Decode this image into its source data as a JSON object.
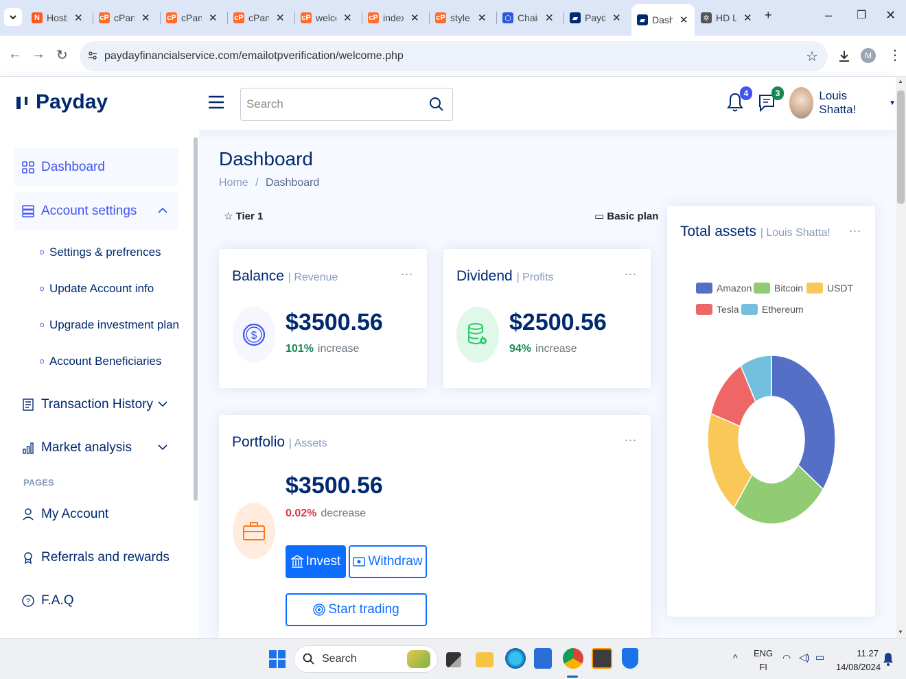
{
  "browser": {
    "tabs": [
      {
        "label": "Hostinger",
        "icon": "hostinger-icon"
      },
      {
        "label": "cPanel",
        "icon": "cpanel-icon"
      },
      {
        "label": "cPanel",
        "icon": "cpanel-icon"
      },
      {
        "label": "cPanel",
        "icon": "cpanel-icon"
      },
      {
        "label": "welcome",
        "icon": "cpanel-icon"
      },
      {
        "label": "index",
        "icon": "cpanel-icon"
      },
      {
        "label": "style",
        "icon": "cpanel-icon"
      },
      {
        "label": "Chain",
        "icon": "chainlink-icon"
      },
      {
        "label": "Payday",
        "icon": "payday-icon"
      },
      {
        "label": "Dashboard",
        "icon": "payday-icon",
        "active": true
      },
      {
        "label": "HD Lines",
        "icon": "openai-icon"
      }
    ],
    "url": "paydayfinancialservice.com/emailotpverification/welcome.php",
    "profile_initial": "M"
  },
  "header": {
    "logo_text": "Payday",
    "search_placeholder": "Search",
    "notifications_count": "4",
    "messages_count": "3",
    "user_name": "Louis Shatta!"
  },
  "sidebar": {
    "dashboard": "Dashboard",
    "account_settings": "Account settings",
    "sub_items": [
      "Settings & prefrences",
      "Update Account info",
      "Upgrade investment plan",
      "Account Beneficiaries"
    ],
    "transaction_history": "Transaction History",
    "market_analysis": "Market analysis",
    "pages_heading": "PAGES",
    "my_account": "My Account",
    "referrals": "Referrals and rewards",
    "faq": "F.A.Q"
  },
  "main": {
    "title": "Dashboard",
    "breadcrumb_home": "Home",
    "breadcrumb_sep": "/",
    "breadcrumb_current": "Dashboard",
    "tier": "Tier 1",
    "plan": "Basic plan",
    "balance": {
      "title": "Balance",
      "subtitle": "| Revenue",
      "amount": "$3500.56",
      "pct": "101%",
      "trend": "increase"
    },
    "dividend": {
      "title": "Dividend",
      "subtitle": "| Profits",
      "amount": "$2500.56",
      "pct": "94%",
      "trend": "increase"
    },
    "portfolio": {
      "title": "Portfolio",
      "subtitle": "| Assets",
      "amount": "$3500.56",
      "pct": "0.02%",
      "trend": "decrease",
      "invest": "Invest",
      "withdraw": "Withdraw",
      "start_trading": "Start trading"
    },
    "more_menu": "..."
  },
  "chart_data": {
    "type": "pie",
    "title": "Total assets",
    "subtitle": "| Louis Shatta!",
    "categories": [
      "Amazon",
      "Bitcoin",
      "USDT",
      "Tesla",
      "Ethereum"
    ],
    "values": [
      35,
      25,
      20,
      12,
      8
    ],
    "colors": [
      "#5470c6",
      "#91cc75",
      "#fac858",
      "#ee6666",
      "#73c0de"
    ],
    "donut": true,
    "legend_position": "top"
  },
  "taskbar": {
    "search_placeholder": "Search",
    "lang_top": "ENG",
    "lang_bottom": "FI",
    "time": "11.27",
    "date": "14/08/2024"
  }
}
